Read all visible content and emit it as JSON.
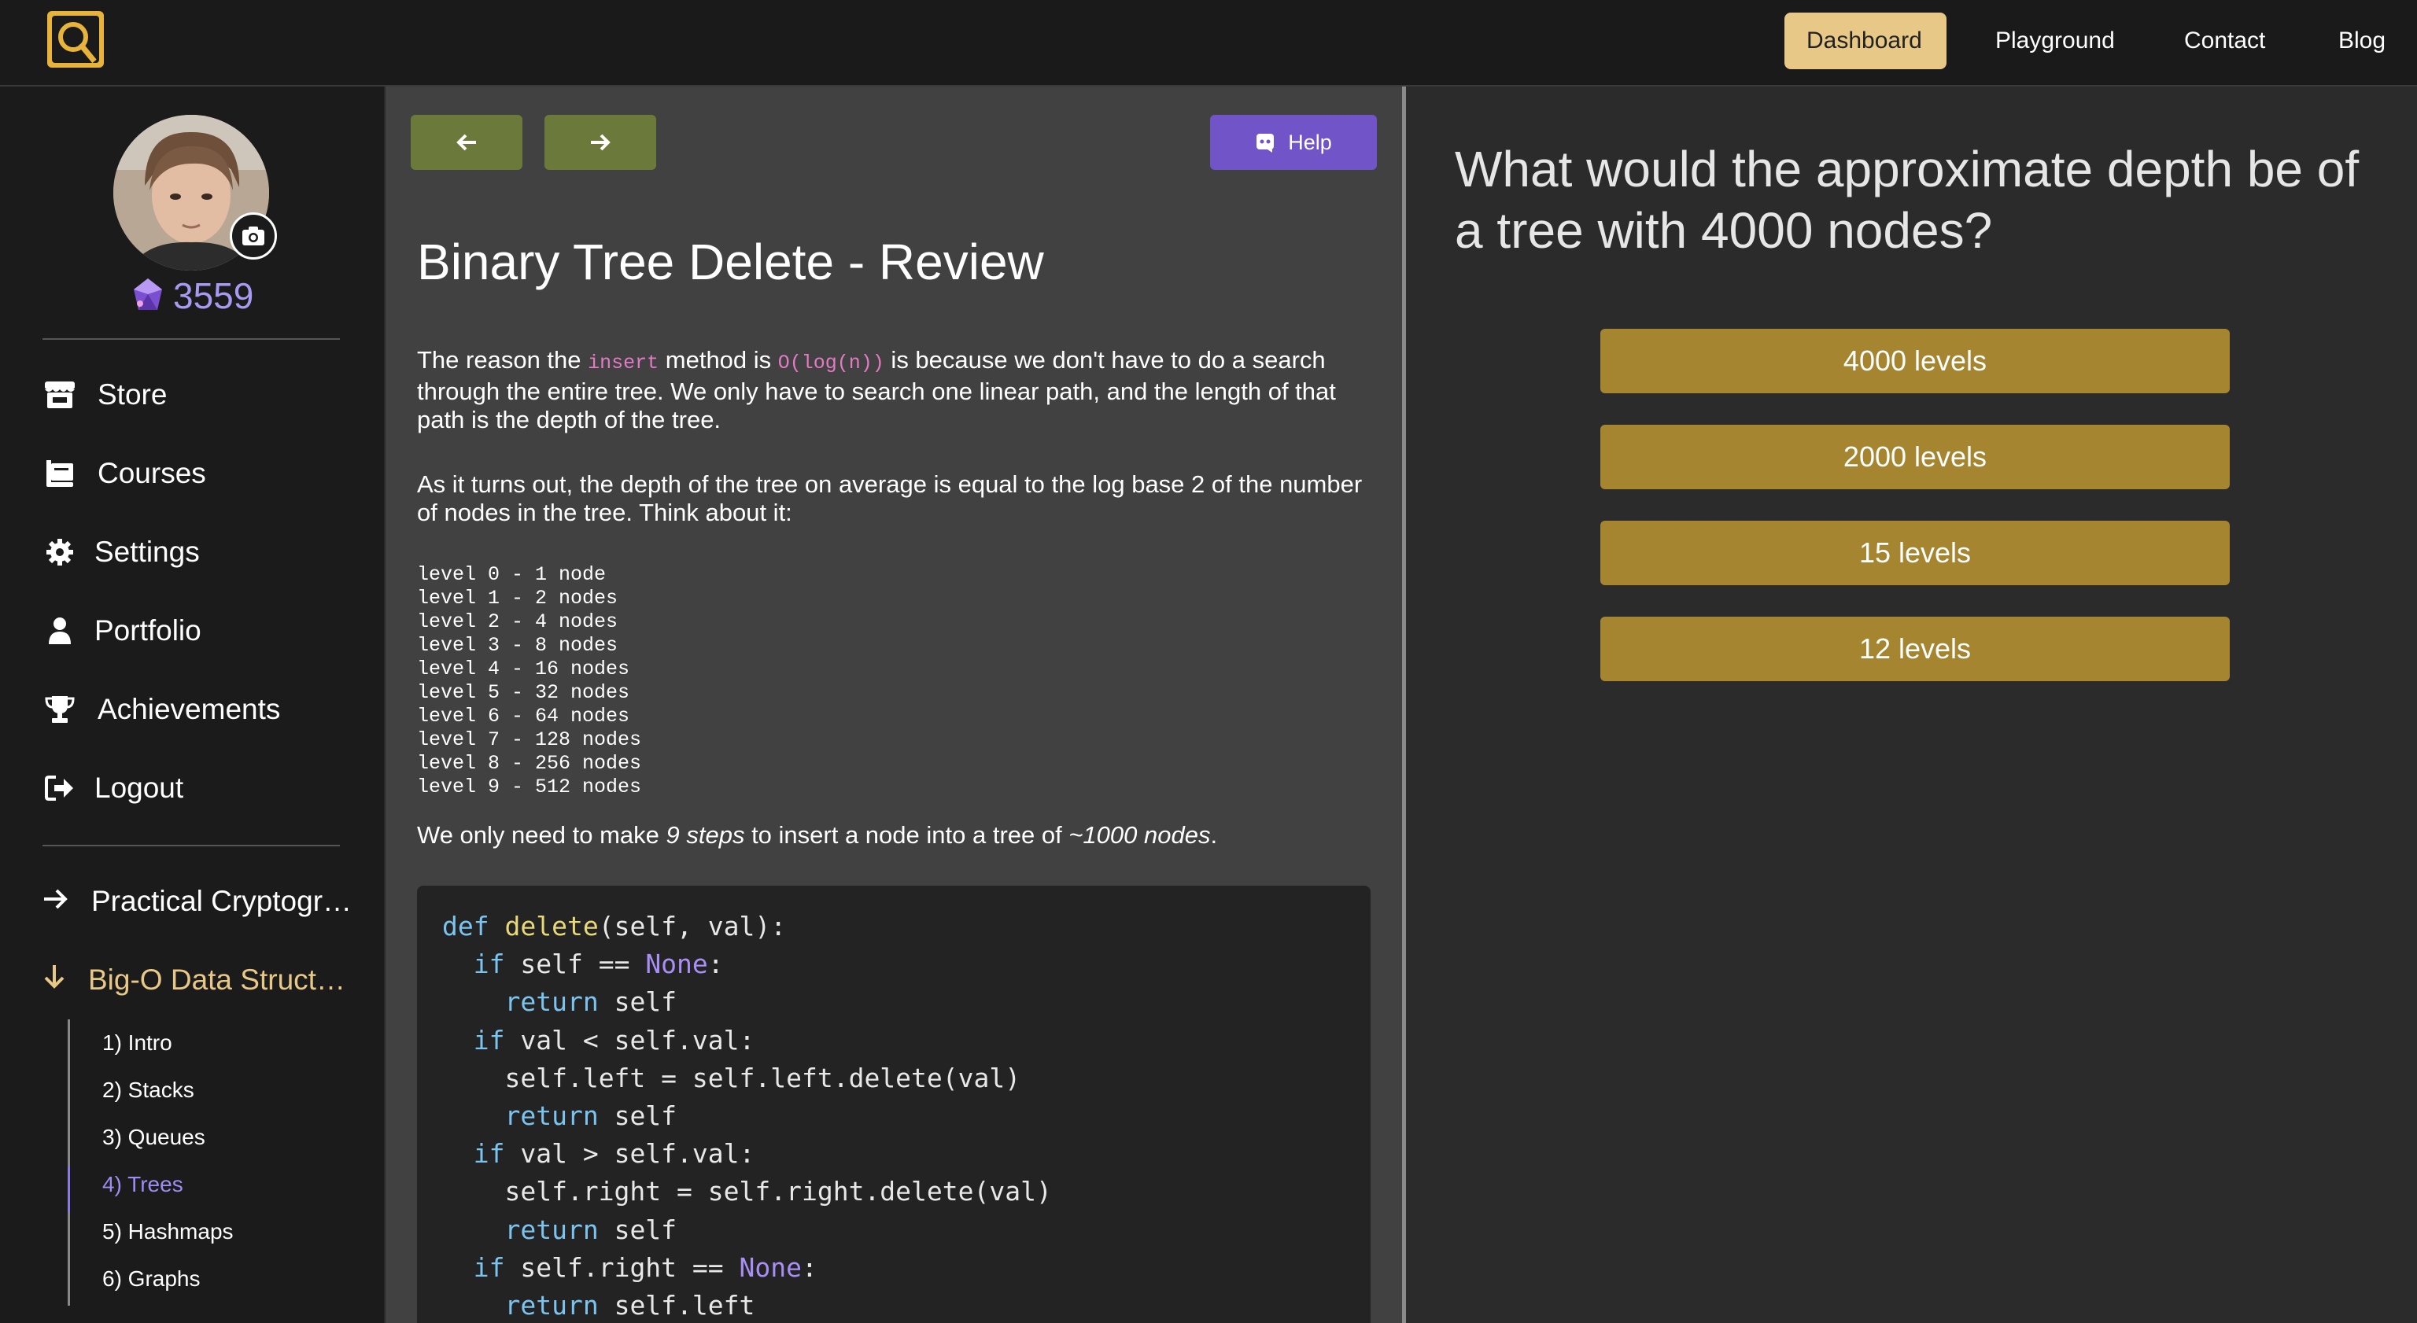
{
  "nav": {
    "links": [
      {
        "label": "Dashboard",
        "active": true
      },
      {
        "label": "Playground",
        "active": false
      },
      {
        "label": "Contact",
        "active": false
      },
      {
        "label": "Blog",
        "active": false
      }
    ]
  },
  "profile": {
    "gems": "3559"
  },
  "sidebar": {
    "menu": [
      {
        "label": "Store",
        "icon": "store-icon"
      },
      {
        "label": "Courses",
        "icon": "courses-icon"
      },
      {
        "label": "Settings",
        "icon": "gear-icon"
      },
      {
        "label": "Portfolio",
        "icon": "person-icon"
      },
      {
        "label": "Achievements",
        "icon": "trophy-icon"
      },
      {
        "label": "Logout",
        "icon": "logout-icon"
      }
    ],
    "courses": [
      {
        "label": "Practical Cryptography",
        "open": false
      },
      {
        "label": "Big-O Data Structures",
        "open": true
      }
    ],
    "chapters": [
      {
        "label": "1) Intro",
        "active": false
      },
      {
        "label": "2) Stacks",
        "active": false
      },
      {
        "label": "3) Queues",
        "active": false
      },
      {
        "label": "4) Trees",
        "active": true
      },
      {
        "label": "5) Hashmaps",
        "active": false
      },
      {
        "label": "6) Graphs",
        "active": false
      }
    ]
  },
  "lesson": {
    "help_label": "Help",
    "title": "Binary Tree Delete - Review",
    "p1": {
      "before": "The reason the ",
      "code1": "insert",
      "middle": " method is ",
      "code2": "O(log(n))",
      "after": " is because we don't have to do a search through the entire tree. We only have to search one linear path, and the length of that path is the depth of the tree."
    },
    "p2": "As it turns out, the depth of the tree on average is equal to the log base 2 of the number of nodes in the tree. Think about it:",
    "levels": [
      "level 0 - 1 node",
      "level 1 - 2 nodes",
      "level 2 - 4 nodes",
      "level 3 - 8 nodes",
      "level 4 - 16 nodes",
      "level 5 - 32 nodes",
      "level 6 - 64 nodes",
      "level 7 - 128 nodes",
      "level 8 - 256 nodes",
      "level 9 - 512 nodes"
    ],
    "p3": {
      "before": "We only need to make ",
      "em1": "9 steps",
      "middle": " to insert a node into a tree of ",
      "em2": "~1000 nodes",
      "after": "."
    },
    "code": {
      "l1_kw": "def",
      "l1_fn": "delete",
      "l1_rest": "(self, val):",
      "l2_kw": "if",
      "l2_rest": " self == ",
      "l2_con": "None",
      "l2_end": ":",
      "l3_kw": "return",
      "l3_rest": " self",
      "l4_kw": "if",
      "l4_rest": " val < self.val:",
      "l5": "self.left = self.left.delete(val)",
      "l6_kw": "return",
      "l6_rest": " self",
      "l7_kw": "if",
      "l7_rest": " val > self.val:",
      "l8": "self.right = self.right.delete(val)",
      "l9_kw": "return",
      "l9_rest": " self",
      "l10_kw": "if",
      "l10_rest": " self.right == ",
      "l10_con": "None",
      "l10_end": ":",
      "l11_kw": "return",
      "l11_rest": " self.left"
    }
  },
  "quiz": {
    "question": "What would the approximate depth be of a tree with 4000 nodes?",
    "answers": [
      "4000 levels",
      "2000 levels",
      "15 levels",
      "12 levels"
    ]
  },
  "colors": {
    "accent": "#e8c886",
    "answer": "#a58530",
    "help": "#7054c8",
    "arrow": "#6b7a3a",
    "gems": "#a89af0"
  }
}
